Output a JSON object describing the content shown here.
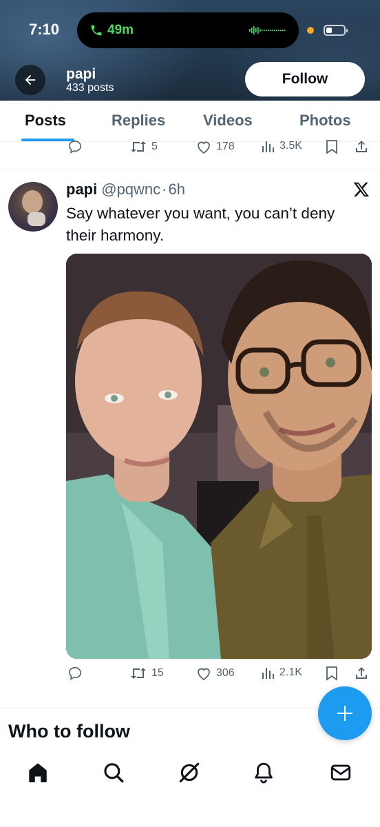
{
  "status_bar": {
    "time": "7:10",
    "call_duration": "49m",
    "accent_call": "#4cd964",
    "indicator_color": "#f5a623"
  },
  "header": {
    "back_icon": "arrow-left-icon",
    "profile_name": "papi",
    "post_count": "433 posts",
    "follow_label": "Follow"
  },
  "tabs": [
    {
      "label": "Posts",
      "active": true
    },
    {
      "label": "Replies",
      "active": false
    },
    {
      "label": "Videos",
      "active": false
    },
    {
      "label": "Photos",
      "active": false
    }
  ],
  "previous_tweet_actions": {
    "reply_count": "",
    "retweet_count": "5",
    "like_count": "178",
    "view_count": "3.5K"
  },
  "tweet": {
    "author_name": "papi",
    "handle": "@pqwnc",
    "separator": "·",
    "time_ago": "6h",
    "text": "Say whatever you want, you can’t deny their harmony.",
    "image_alt_icon": "photo-two-men",
    "actions": {
      "reply_count": "",
      "retweet_count": "15",
      "like_count": "306",
      "view_count": "2.1K"
    }
  },
  "who_to_follow": {
    "heading": "Who to follow"
  },
  "fab": {
    "icon": "plus-icon",
    "color": "#1d9bf0"
  },
  "bottom_nav": [
    {
      "icon": "home-icon",
      "active": true
    },
    {
      "icon": "search-icon",
      "active": false
    },
    {
      "icon": "grok-icon",
      "active": false
    },
    {
      "icon": "bell-icon",
      "active": false
    },
    {
      "icon": "mail-icon",
      "active": false
    }
  ],
  "colors": {
    "accent": "#1d9bf0",
    "text_primary": "#0f1419",
    "text_secondary": "#536471"
  }
}
